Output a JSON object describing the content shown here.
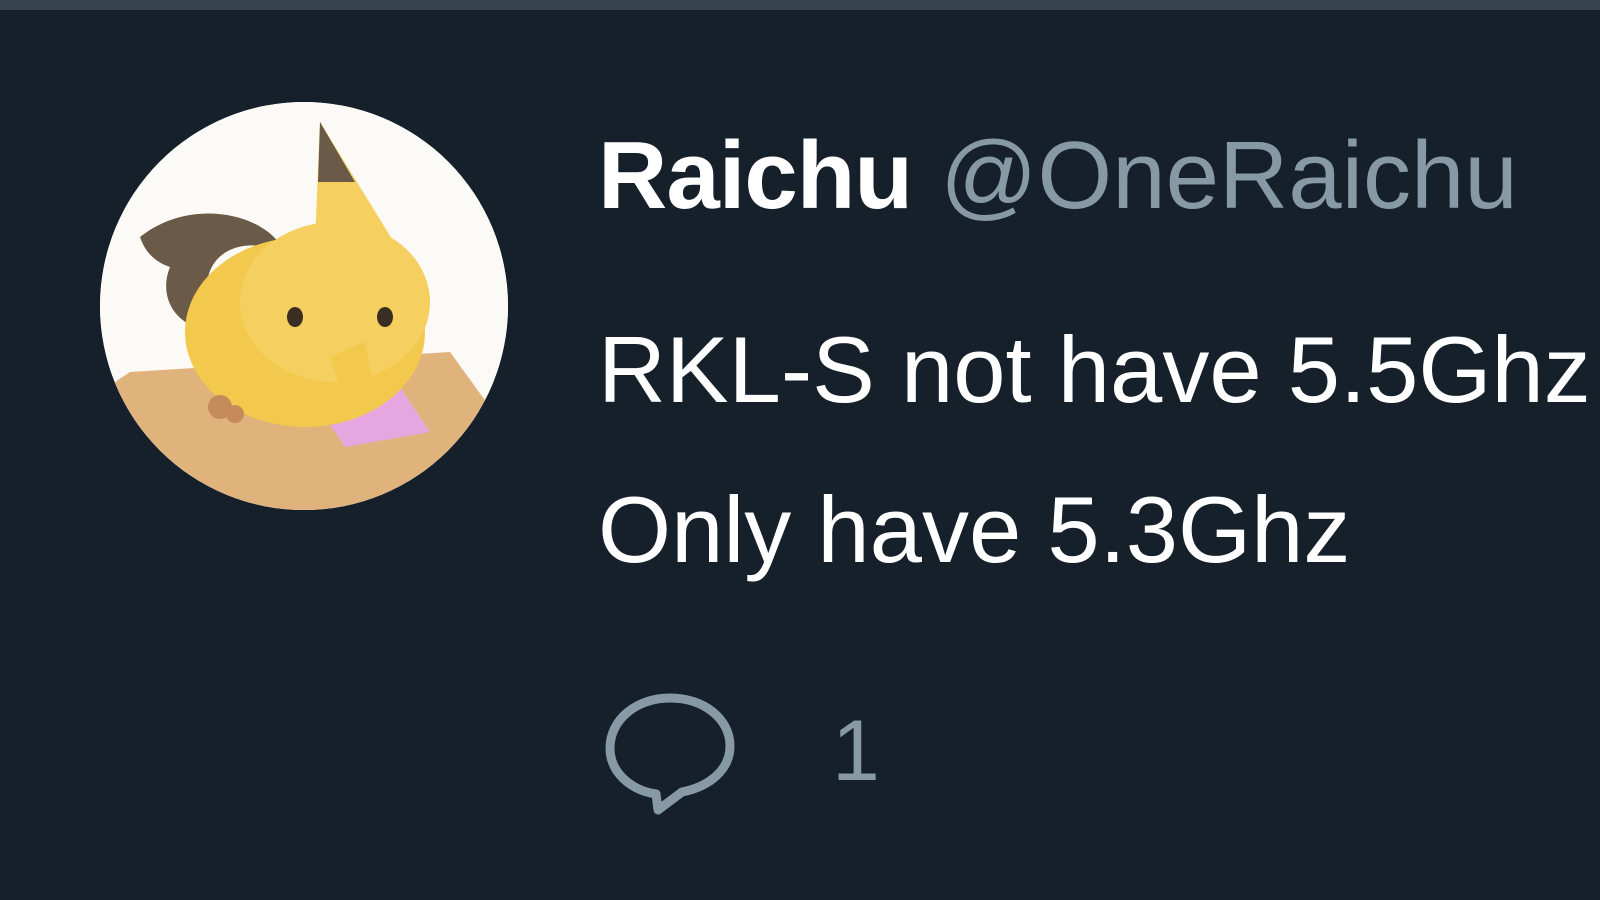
{
  "tweet": {
    "author": {
      "display_name": "Raichu",
      "handle": "@OneRaichu"
    },
    "text_lines": [
      "RKL-S not have 5.5Ghz",
      "Only have 5.3Ghz"
    ],
    "actions": {
      "reply_icon": "speech-bubble-icon",
      "reply_count": "1"
    }
  },
  "colors": {
    "background": "#15202b",
    "text_primary": "#ffffff",
    "text_secondary": "#8899a6"
  }
}
